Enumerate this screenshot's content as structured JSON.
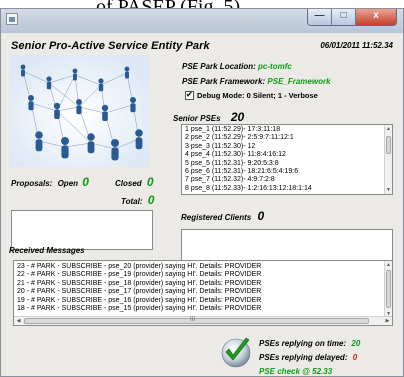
{
  "caption": "of PASEP (Fig. 5).",
  "window": {
    "minimize": "—",
    "maximize": "□",
    "close": "x"
  },
  "header": {
    "title": "Senior Pro-Active Service Entity Park",
    "date": "06/01/2011 11:52.34"
  },
  "park": {
    "location_label": "PSE Park Location:",
    "location_value": "pc-tomfc",
    "framework_label": "PSE Park Framework:",
    "framework_value": "PSE_Framework",
    "debug_label": "Debug Mode: 0 Silent; 1 - Verbose"
  },
  "senior_pses": {
    "label": "Senior PSEs",
    "count": "20",
    "items": [
      "1 pse_1 (11:52.29)- 17:3:11:18",
      "2 pse_2 (11:52.29)- 2:5:9:7:11:12:1",
      "3 pse_3 (11:52.30)- 12",
      "4 pse_4 (11:52.30)- 11:8:4:16:12",
      "5 pse_5 (11:52.31)- 9:20:5:3:8",
      "6 pse_6 (11:52.31)- 18:21:6:5:4:19:6",
      "7 pse_7 (11:52.32)- 4:9:7:2:8",
      "8 pse_8 (11:52.33)- 1:2:16:13:12:18:1:14"
    ]
  },
  "proposals": {
    "label": "Proposals:",
    "open_label": "Open",
    "open_value": "0",
    "closed_label": "Closed",
    "closed_value": "0",
    "total_label": "Total:",
    "total_value": "0"
  },
  "registered_clients": {
    "label": "Registered Clients",
    "count": "0"
  },
  "received_messages": {
    "label": "Received Messages",
    "items": [
      "23 - # PARK - SUBSCRIBE - pse_20 (provider) saying HI'. Details: PROVIDER",
      "22 - # PARK - SUBSCRIBE - pse_19 (provider) saying HI'. Details: PROVIDER",
      "21 - # PARK - SUBSCRIBE - pse_18 (provider) saying HI'. Details: PROVIDER",
      "20 - # PARK - SUBSCRIBE - pse_17 (provider) saying HI'. Details: PROVIDER",
      "19 - # PARK - SUBSCRIBE - pse_16 (provider) saying HI'. Details: PROVIDER",
      "18 - # PARK - SUBSCRIBE - pse_15 (provider) saying HI'. Details: PROVIDER"
    ]
  },
  "status": {
    "on_time_label": "PSEs replying on time:",
    "on_time_value": "20",
    "delayed_label": "PSEs replying delayed:",
    "delayed_value": "0",
    "check_label": "PSE check @ 52.33"
  },
  "colors": {
    "green": "#0c9c12",
    "red": "#d61a1a",
    "close_button": "#c7402a",
    "titlebar": "#c6d2e0"
  },
  "icons": {
    "app": "window-app-icon",
    "network": "people-network-image",
    "status": "check-mark-icon"
  }
}
